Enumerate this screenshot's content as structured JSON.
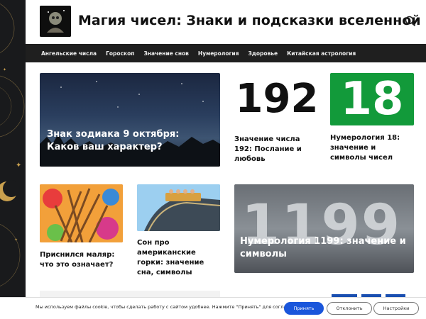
{
  "site": {
    "title": "Магия чисел: Знаки и подсказки вселенной"
  },
  "nav": {
    "items": [
      "Ангельские числа",
      "Гороскоп",
      "Значение снов",
      "Нумерология",
      "Здоровье",
      "Китайская астрология"
    ]
  },
  "articles": {
    "zodiac": "Знак зодиака 9 октября: Каков ваш характер?",
    "n192": {
      "number": "192",
      "title": "Значение числа 192: Послание и любовь"
    },
    "n18": {
      "number": "18",
      "title": "Нумерология 18: значение и символы чисел"
    },
    "painter": "Приснился маляр: что это означает?",
    "coaster": "Сон про американские горки: значение сна, символы",
    "n1199": {
      "number": "1199",
      "title": "Нумерология 1199: значение и символы"
    }
  },
  "cookie": {
    "text": "Мы используем файлы cookie, чтобы сделать работу с сайтом удобнее. Нажмите \"Принять\" для согласия.",
    "accept": "Принять",
    "reject": "Отклонить",
    "settings": "Настройки"
  }
}
